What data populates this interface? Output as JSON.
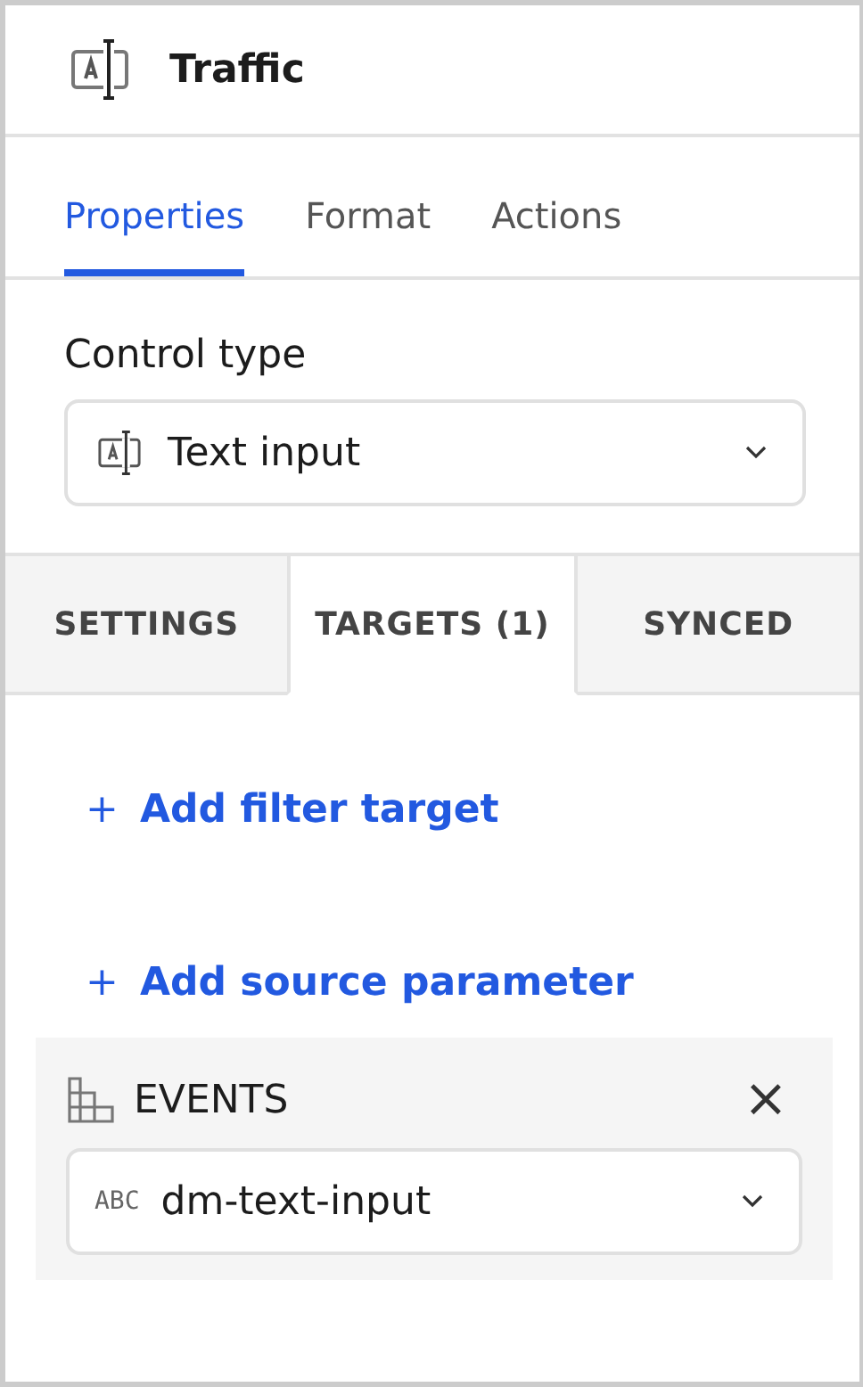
{
  "header": {
    "title": "Traffic"
  },
  "tabs": [
    {
      "label": "Properties",
      "selected": true
    },
    {
      "label": "Format",
      "selected": false
    },
    {
      "label": "Actions",
      "selected": false
    }
  ],
  "control_type": {
    "label": "Control type",
    "value": "Text input"
  },
  "subtabs": [
    {
      "label": "SETTINGS",
      "selected": false
    },
    {
      "label": "TARGETS (1)",
      "selected": true
    },
    {
      "label": "SYNCED",
      "selected": false
    }
  ],
  "actions": [
    {
      "icon": "+",
      "label": "Add filter target"
    },
    {
      "icon": "+",
      "label": "Add source parameter"
    }
  ],
  "source": {
    "title": "EVENTS",
    "close": "×",
    "type_tag": "ABC",
    "value": "dm-text-input"
  }
}
